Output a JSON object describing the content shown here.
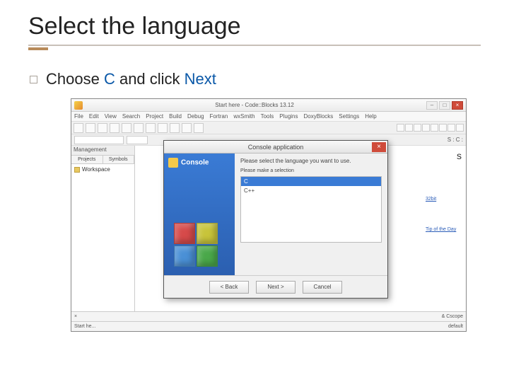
{
  "slide": {
    "title": "Select the language",
    "bullet_pre": "Choose ",
    "bullet_em1": "C",
    "bullet_mid": " and click ",
    "bullet_em2": "Next"
  },
  "app": {
    "title": "Start here - Code::Blocks 13.12",
    "menus": [
      "File",
      "Edit",
      "View",
      "Search",
      "Project",
      "Build",
      "Debug",
      "Fortran",
      "wxSmith",
      "Tools",
      "Plugins",
      "DoxyBlocks",
      "Settings",
      "Help"
    ],
    "sidebar": {
      "header": "Management",
      "tabs": [
        "Projects",
        "Symbols"
      ],
      "workspace": "Workspace"
    },
    "right_fragment": "s",
    "right_link1": "32bit",
    "right_link2": "Tip of the Day",
    "bottom_right": "& Cscope",
    "status_left": "Start he...",
    "status_right": "default"
  },
  "dialog": {
    "title": "Console application",
    "side_label": "Console",
    "prompt": "Please select the language you want to use.",
    "sub": "Please make a selection",
    "options": [
      "C",
      "C++"
    ],
    "btn_back": "< Back",
    "btn_next": "Next >",
    "btn_cancel": "Cancel"
  }
}
